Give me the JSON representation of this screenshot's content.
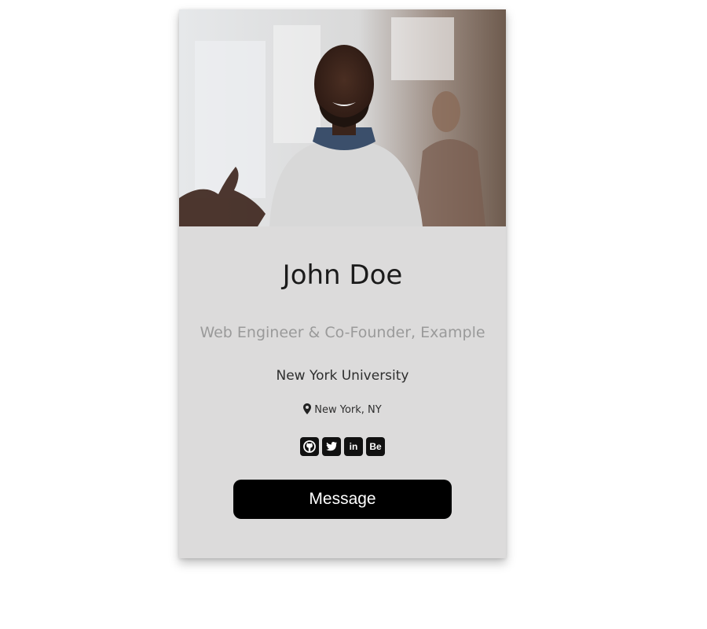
{
  "profile": {
    "name": "John Doe",
    "title": "Web Engineer & Co-Founder, Example",
    "school": "New York University",
    "location": "New York, NY"
  },
  "socials": [
    {
      "icon": "github-icon"
    },
    {
      "icon": "twitter-icon"
    },
    {
      "icon": "linkedin-icon",
      "label": "in"
    },
    {
      "icon": "behance-icon",
      "label": "Be"
    }
  ],
  "actions": {
    "message_label": "Message"
  },
  "colors": {
    "card_background": "#dcdbdb",
    "button_background": "#000000",
    "title_text": "#9a9a9a"
  }
}
